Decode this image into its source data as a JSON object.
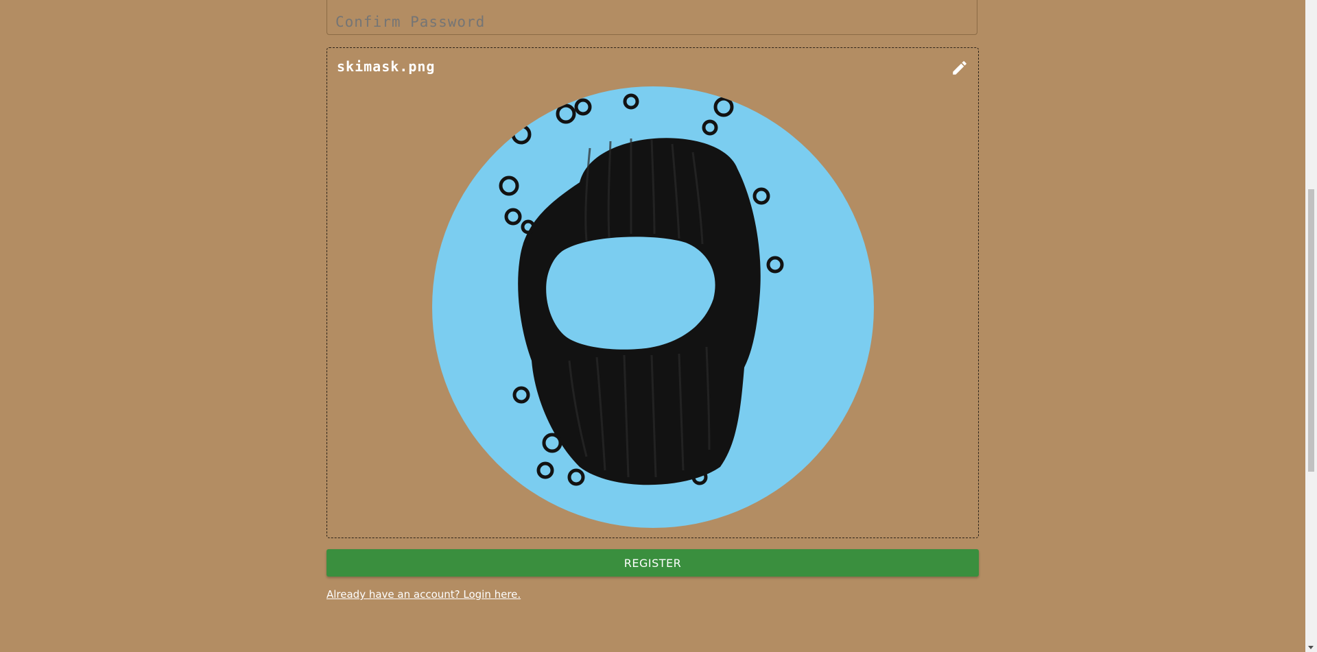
{
  "form": {
    "confirm_password_placeholder": "Confirm Password",
    "upload": {
      "filename": "skimask.png",
      "edit_icon": "pencil-icon",
      "avatar_alt": "Uploaded avatar: black knit ski mask on light blue circle"
    },
    "register_label": "REGISTER",
    "login_link": "Already have an account? Login here."
  },
  "colors": {
    "background": "#b38d63",
    "register_button": "#3a8f3e",
    "avatar_circle": "#7bcdf0",
    "mask": "#121212"
  }
}
